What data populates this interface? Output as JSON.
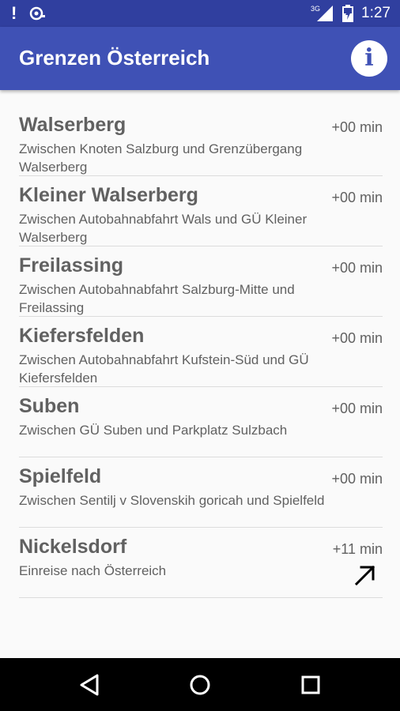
{
  "status_bar": {
    "network": "3G",
    "time": "1:27"
  },
  "app": {
    "title": "Grenzen Österreich",
    "info_icon": "info-icon"
  },
  "crossings": [
    {
      "name": "Walserberg",
      "delay": "+00 min",
      "description": "Zwischen Knoten Salzburg und Grenzübergang Walserberg"
    },
    {
      "name": "Kleiner Walserberg",
      "delay": "+00 min",
      "description": "Zwischen Autobahnabfahrt Wals und GÜ Kleiner Walserberg"
    },
    {
      "name": "Freilassing",
      "delay": "+00 min",
      "description": "Zwischen Autobahnabfahrt Salzburg-Mitte und Freilassing"
    },
    {
      "name": "Kiefersfelden",
      "delay": "+00 min",
      "description": "Zwischen Autobahnabfahrt Kufstein-Süd und GÜ Kiefersfelden"
    },
    {
      "name": "Suben",
      "delay": "+00 min",
      "description": "Zwischen GÜ Suben und Parkplatz Sulzbach"
    },
    {
      "name": "Spielfeld",
      "delay": "+00 min",
      "description": "Zwischen Sentilj v Slovenskih goricah und Spielfeld"
    },
    {
      "name": "Nickelsdorf",
      "delay": "+11 min",
      "description": "Einreise nach Österreich",
      "trend_icon": "arrow-up-right-icon"
    }
  ],
  "colors": {
    "status_bar": "#303f9f",
    "app_bar": "#3f51b5",
    "text": "#616161",
    "background": "#fafafa"
  }
}
